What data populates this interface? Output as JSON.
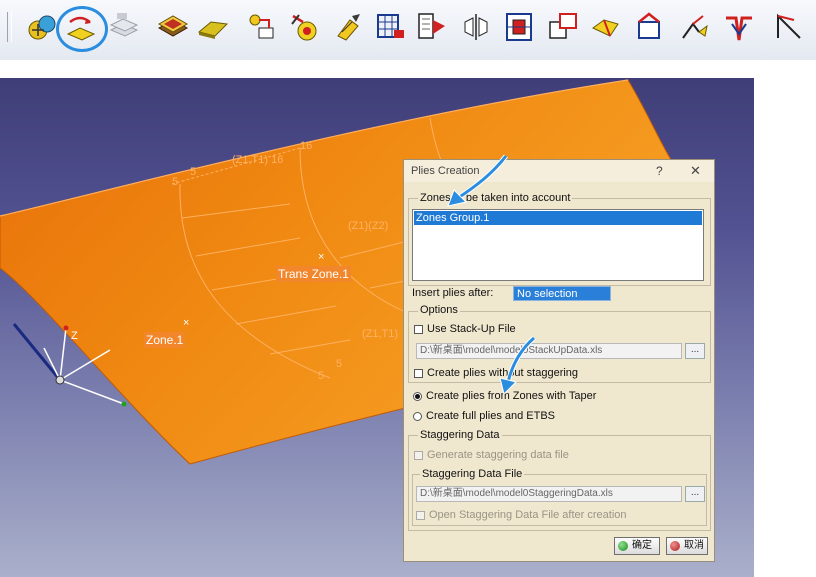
{
  "toolbar": {
    "icons": [
      "composites-group-icon",
      "plies-from-zones-icon",
      "plies-group-icon",
      "ply-table-icon",
      "plies-solid-icon",
      "ply-split-icon",
      "sequence-icon",
      "drape-icon",
      "grid-panel-icon",
      "flatten-icon",
      "symmetry-icon",
      "core-sample-icon",
      "explode-icon",
      "transition-icon",
      "ply-exploder-icon",
      "cutting-icon",
      "darts-icon",
      "rosette-icon"
    ]
  },
  "viewport": {
    "labels": {
      "trans_zone": "Trans Zone.1",
      "zone": "Zone.1",
      "z1t1_16": "(Z1,T1) 16",
      "z1z2": "(Z1)(Z2)",
      "z1t1": "(Z1,T1)",
      "n16": "16",
      "n5a": "5",
      "n5b": "5",
      "n5c": "5",
      "n5d": "5",
      "axis_z": "Z"
    }
  },
  "dialog": {
    "title": "Plies Creation",
    "help": "?",
    "close": "✕",
    "zones_group_label": "Zones to be taken into account",
    "zones_list": [
      "Zones Group.1"
    ],
    "insert_after_label": "Insert plies after:",
    "insert_after_value": "No selection",
    "options_label": "Options",
    "use_stackup_label": "Use Stack-Up File",
    "stackup_path": "D:\\新桌面\\model\\model0StackUpData.xls",
    "no_staggering_label": "Create plies without staggering",
    "radio_taper_label": "Create plies from Zones with Taper",
    "radio_full_label": "Create full plies and ETBS",
    "staggering_data_label": "Staggering Data",
    "generate_staggering_label": "Generate staggering data file",
    "staggering_file_label": "Staggering Data File",
    "staggering_path": "D:\\新桌面\\model\\model0StaggeringData.xls",
    "open_staggering_label": "Open Staggering Data File after creation",
    "browse_label": "...",
    "ok_label": "确定",
    "cancel_label": "取消",
    "colors": {
      "accent": "#1f7ad6",
      "dialog_bg": "#f0e7cf",
      "surface": "#f08a12"
    }
  }
}
